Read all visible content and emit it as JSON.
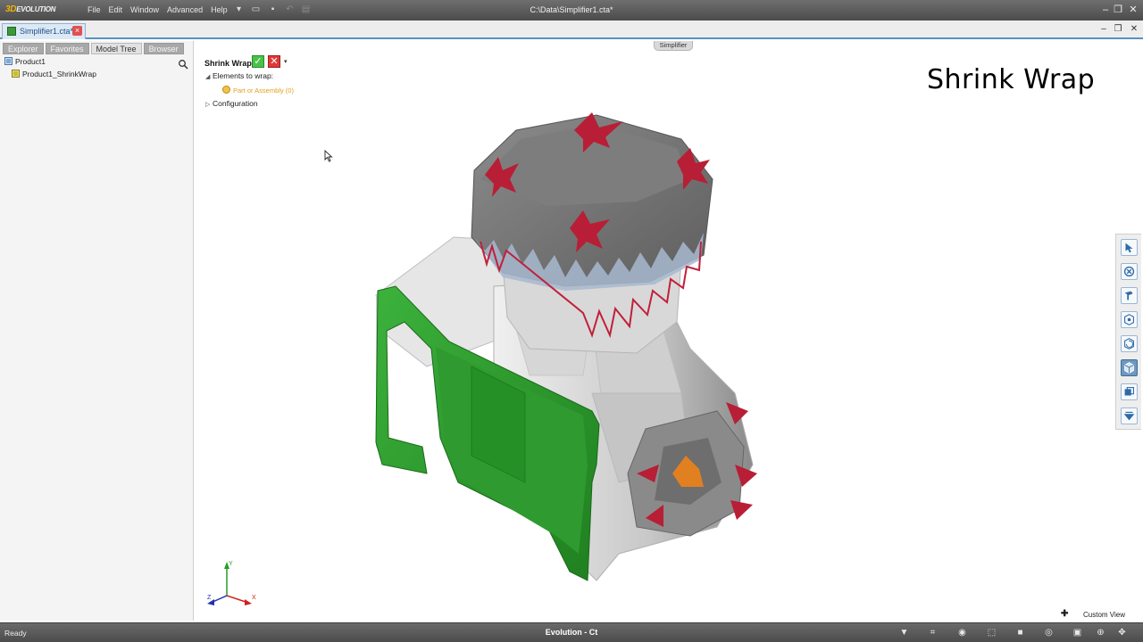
{
  "titlebar": {
    "logo_prefix": "3D",
    "logo_suffix": "EVOLUTION",
    "menu": [
      "File",
      "Edit",
      "Window",
      "Advanced",
      "Help"
    ],
    "document_path": "C:\\Data\\Simplifier1.cta*"
  },
  "document_tab": {
    "label": "Simplifier1.cta*"
  },
  "left_panel": {
    "tabs": [
      "Explorer",
      "Favorites",
      "Model Tree",
      "Browser"
    ],
    "active_tab": "Model Tree",
    "tree": [
      {
        "label": "Product1"
      },
      {
        "label": "Product1_ShrinkWrap"
      }
    ]
  },
  "viewport": {
    "workbench_tab": "Simplifier",
    "overlay_title": "Shrink Wrap",
    "command": {
      "title": "Shrink Wrap",
      "section_elements": "Elements to wrap:",
      "placeholder": "Part or Assembly (0)",
      "section_config": "Configuration"
    },
    "triad": {
      "x": "X",
      "y": "Y",
      "z": "Z"
    },
    "custom_view_label": "Custom View"
  },
  "right_toolbar": {
    "icons": [
      "select-icon",
      "close-circle-icon",
      "paint-icon",
      "visibility-icon",
      "rotate-icon",
      "cube-view-icon",
      "copy-view-icon",
      "shading-icon"
    ],
    "active_index": 5
  },
  "status_bar": {
    "status": "Ready",
    "app_name": "Evolution - Ct"
  },
  "colors": {
    "accent": "#5a8fc0",
    "model_grey": "#b8b8b8",
    "green_face": "#2e9a2e",
    "red_spikes": "#c0203a",
    "orange_mark": "#e08020"
  }
}
